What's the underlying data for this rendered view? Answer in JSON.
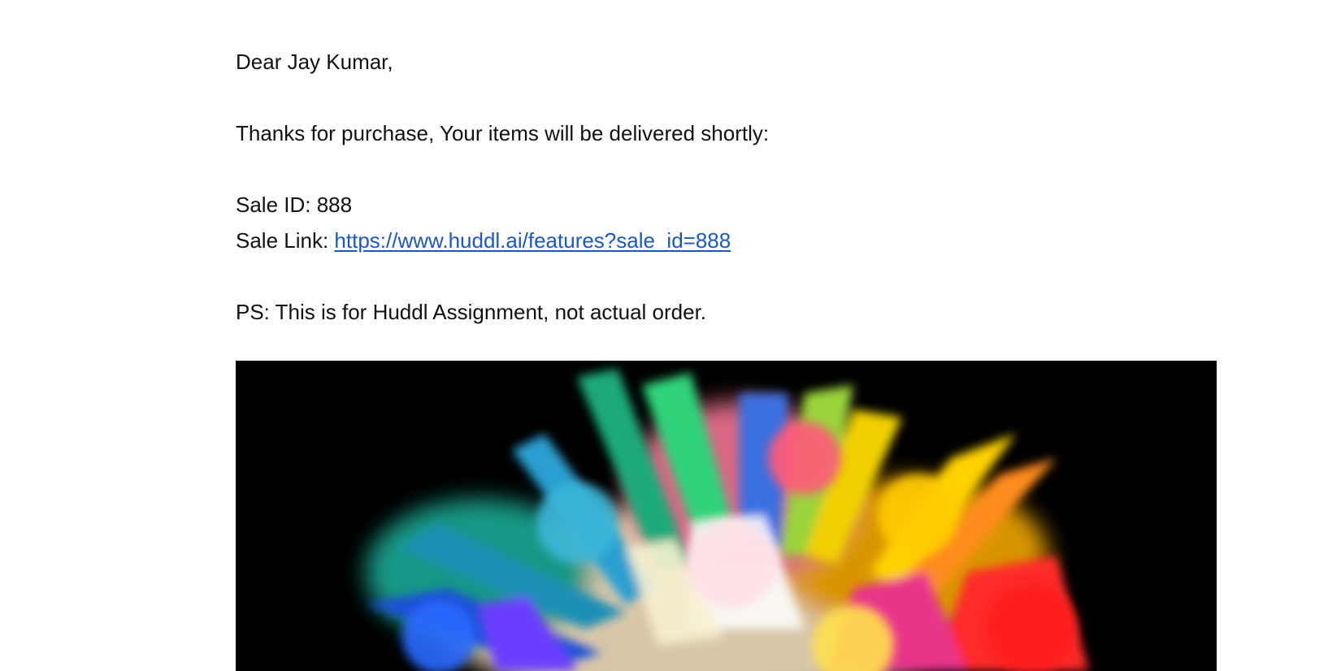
{
  "email": {
    "greeting": "Dear Jay Kumar,",
    "thanks_text": "Thanks for purchase, Your items will be delivered shortly:",
    "sale_id_label": "Sale ID: 888",
    "sale_link_label": "Sale Link: ",
    "sale_link_url": "https://www.huddl.ai/features?sale_id=888",
    "ps_text": "PS: This is for Huddl Assignment, not actual order."
  },
  "banner": {
    "icon": "color-powder-explosion-image",
    "background_color": "#000000",
    "colors": [
      "#1f4fd8",
      "#18b3a3",
      "#2ecc71",
      "#f5d000",
      "#ff8a00",
      "#ff2a2a",
      "#e84aa0",
      "#7a3cff",
      "#ffffff"
    ]
  },
  "colors": {
    "link": "#1a57c9",
    "text": "#111111",
    "background": "#ffffff"
  }
}
